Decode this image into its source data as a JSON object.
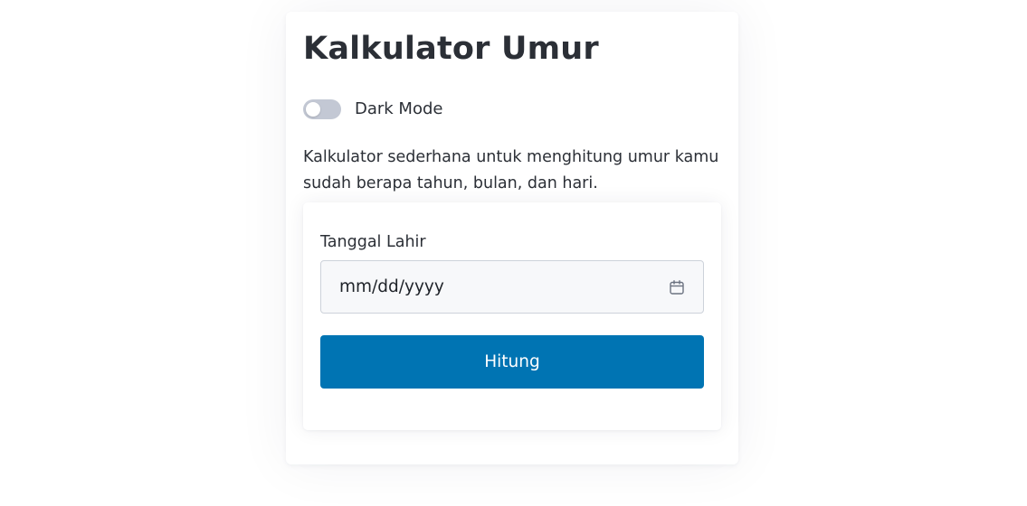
{
  "app": {
    "title": "Kalkulator Umur"
  },
  "dark_mode": {
    "label": "Dark Mode",
    "enabled": false
  },
  "description": "Kalkulator sederhana untuk menghitung umur kamu sudah berapa tahun, bulan, dan hari.",
  "form": {
    "birthdate_label": "Tanggal Lahir",
    "birthdate_value": "",
    "birthdate_placeholder": "mm/dd/yyyy",
    "calendar_icon": "calendar-icon",
    "submit_label": "Hitung"
  },
  "colors": {
    "accent": "#0074b3",
    "toggle_off": "#c3c8d4",
    "text": "#2b2f36",
    "input_bg": "#f7f8fa"
  }
}
